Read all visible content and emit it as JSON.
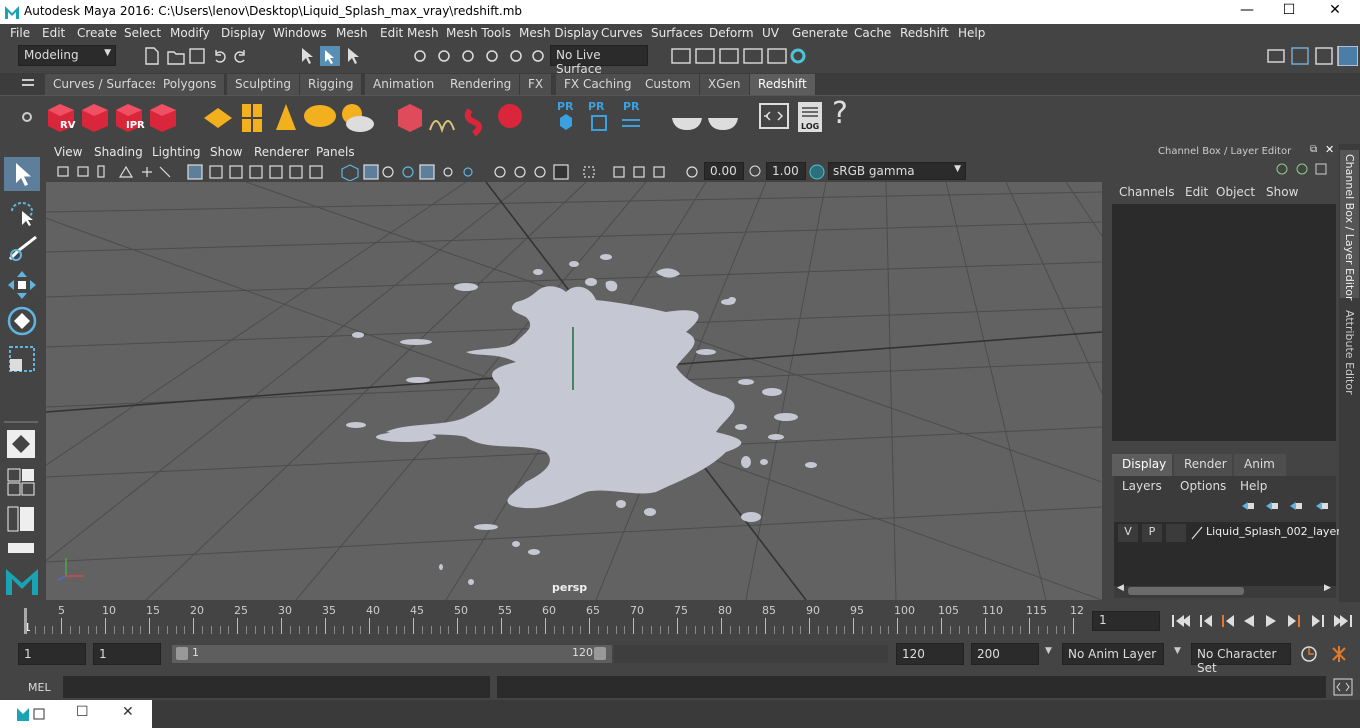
{
  "window": {
    "title": "Autodesk Maya 2016: C:\\Users\\lenov\\Desktop\\Liquid_Splash_max_vray\\redshift.mb",
    "minimize": "—",
    "maximize": "☐",
    "close": "✕"
  },
  "menubar": {
    "items": [
      "File",
      "Edit",
      "Create",
      "Select",
      "Modify",
      "Display",
      "Windows",
      "Mesh",
      "Edit Mesh",
      "Mesh Tools",
      "Mesh Display",
      "Curves",
      "Surfaces",
      "Deform",
      "UV",
      "Generate",
      "Cache",
      "Redshift",
      "Help"
    ]
  },
  "statusline": {
    "mode": "Modeling",
    "live_surface": "No Live Surface"
  },
  "shelf_tabs": {
    "items": [
      "Curves / Surfaces",
      "Polygons",
      "Sculpting",
      "Rigging",
      "Animation",
      "Rendering",
      "FX",
      "FX Caching",
      "Custom",
      "XGen",
      "Redshift"
    ],
    "active": "Redshift"
  },
  "shelf": {
    "rv_label": "RV",
    "ipr_label": "IPR",
    "pr_label": "PR",
    "log_label": "LOG",
    "help_label": "?"
  },
  "viewport_menu": {
    "items": [
      "View",
      "Shading",
      "Lighting",
      "Show",
      "Renderer",
      "Panels"
    ]
  },
  "viewport_toolbar": {
    "exposure": "0.00",
    "gamma": "1.00",
    "colorspace": "sRGB gamma"
  },
  "viewport": {
    "camera_label": "persp",
    "colors": {
      "background": "#626262",
      "grid": "#4a4a4a",
      "splash": "#c5c8d3"
    }
  },
  "channel_box": {
    "title": "Channel Box / Layer Editor",
    "menu": [
      "Channels",
      "Edit",
      "Object",
      "Show"
    ]
  },
  "layer_editor": {
    "tabs": [
      "Display",
      "Render",
      "Anim"
    ],
    "active_tab": "Display",
    "menu": [
      "Layers",
      "Options",
      "Help"
    ],
    "layers": [
      {
        "v": "V",
        "p": "P",
        "name": "Liquid_Splash_002_layer"
      }
    ]
  },
  "side_tabs": {
    "channel_box": "Channel Box / Layer Editor",
    "attribute_editor": "Attribute Editor"
  },
  "timeline": {
    "ticks": [
      "5",
      "10",
      "15",
      "20",
      "25",
      "30",
      "35",
      "40",
      "45",
      "50",
      "55",
      "60",
      "65",
      "70",
      "75",
      "80",
      "85",
      "90",
      "95",
      "100",
      "105",
      "110",
      "115",
      "12"
    ],
    "current_frame_label": "1",
    "current_frame": "1"
  },
  "range": {
    "start": "1",
    "playback_start": "1",
    "slider_start": "1",
    "slider_end": "120",
    "playback_end": "120",
    "end": "200",
    "anim_layer": "No Anim Layer",
    "character_set": "No Character Set"
  },
  "command_line": {
    "label": "MEL",
    "value": ""
  }
}
